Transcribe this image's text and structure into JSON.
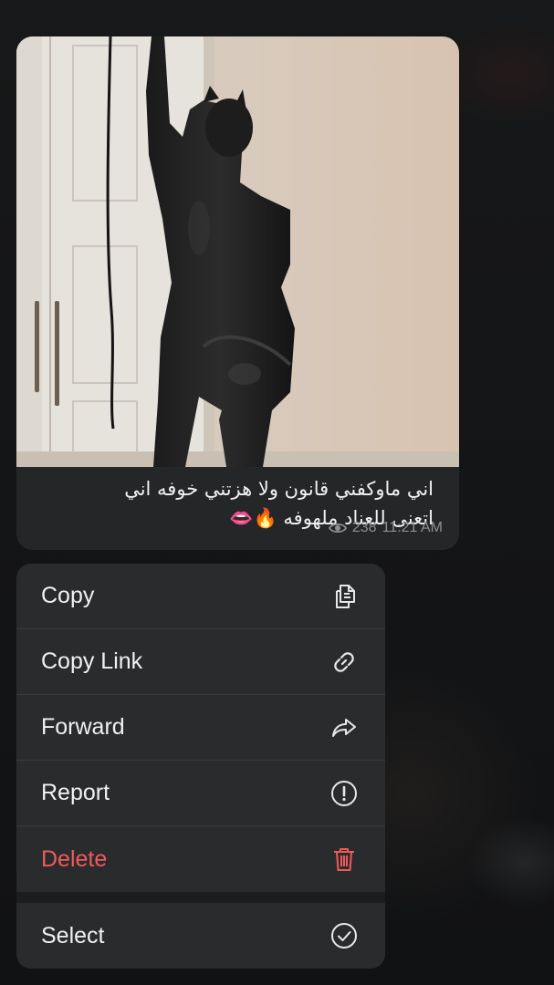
{
  "message": {
    "caption_lines": [
      "اني ماوكفني قانون ولا هزتني خوفه اني",
      "اتعنى للعناد ملهوفه 🔥👄"
    ],
    "views": "238",
    "time": "11:21 AM"
  },
  "context_menu": {
    "items": [
      {
        "label": "Copy",
        "icon": "copy-icon"
      },
      {
        "label": "Copy Link",
        "icon": "link-icon"
      },
      {
        "label": "Forward",
        "icon": "forward-icon"
      },
      {
        "label": "Report",
        "icon": "report-icon"
      },
      {
        "label": "Delete",
        "icon": "trash-icon"
      },
      {
        "label": "Select",
        "icon": "check-circle-icon"
      }
    ],
    "danger_color": "#f05a5a"
  }
}
